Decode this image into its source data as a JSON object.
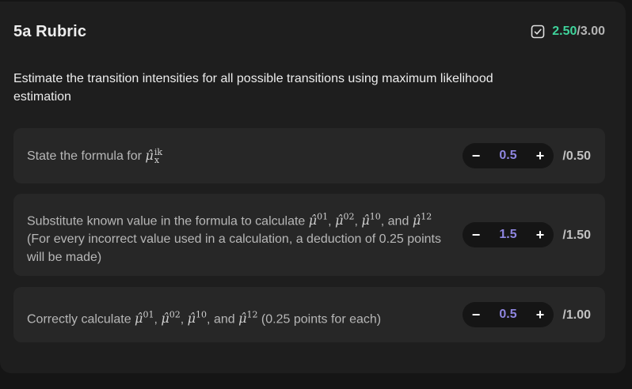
{
  "header": {
    "title": "5a Rubric",
    "score_earned": "2.50",
    "score_total": "/3.00",
    "score_color": "#3fd39b",
    "status_icon": "checkbox-checked-icon"
  },
  "question": "Estimate the transition intensities for all possible transitions using maximum likelihood estimation",
  "criteria": [
    {
      "text_before": "State the formula for ",
      "math": "μ̂",
      "math_sup": "ik",
      "math_sub": "x",
      "value": "0.5",
      "max": "/0.50"
    },
    {
      "text_1": "Substitute known value in the formula to calculate ",
      "m1": "μ̂",
      "m1_sup": "01",
      "sep1": ", ",
      "m2": "μ̂",
      "m2_sup": "02",
      "sep2": ", ",
      "m3": "μ̂",
      "m3_sup": "10",
      "sep3": ", and",
      "m4": "μ̂",
      "m4_sup": "12",
      "text_2": " (For every incorrect value used in a calculation, a deduction of 0.25 points will be made)",
      "value": "1.5",
      "max": "/1.50"
    },
    {
      "text_1": "Correctly calculate ",
      "m1": "μ̂",
      "m1_sup": "01",
      "sep1": ", ",
      "m2": "μ̂",
      "m2_sup": "02",
      "sep2": ", ",
      "m3": "μ̂",
      "m3_sup": "10",
      "sep3": ", and ",
      "m4": "μ̂",
      "m4_sup": "12",
      "text_2": " (0.25 points for each)",
      "value": "0.5",
      "max": "/1.00"
    }
  ],
  "stepper": {
    "minus": "−",
    "plus": "+"
  },
  "colors": {
    "accent_value": "#8f86e0",
    "background": "#1e1e1e",
    "item_background": "#272727"
  }
}
